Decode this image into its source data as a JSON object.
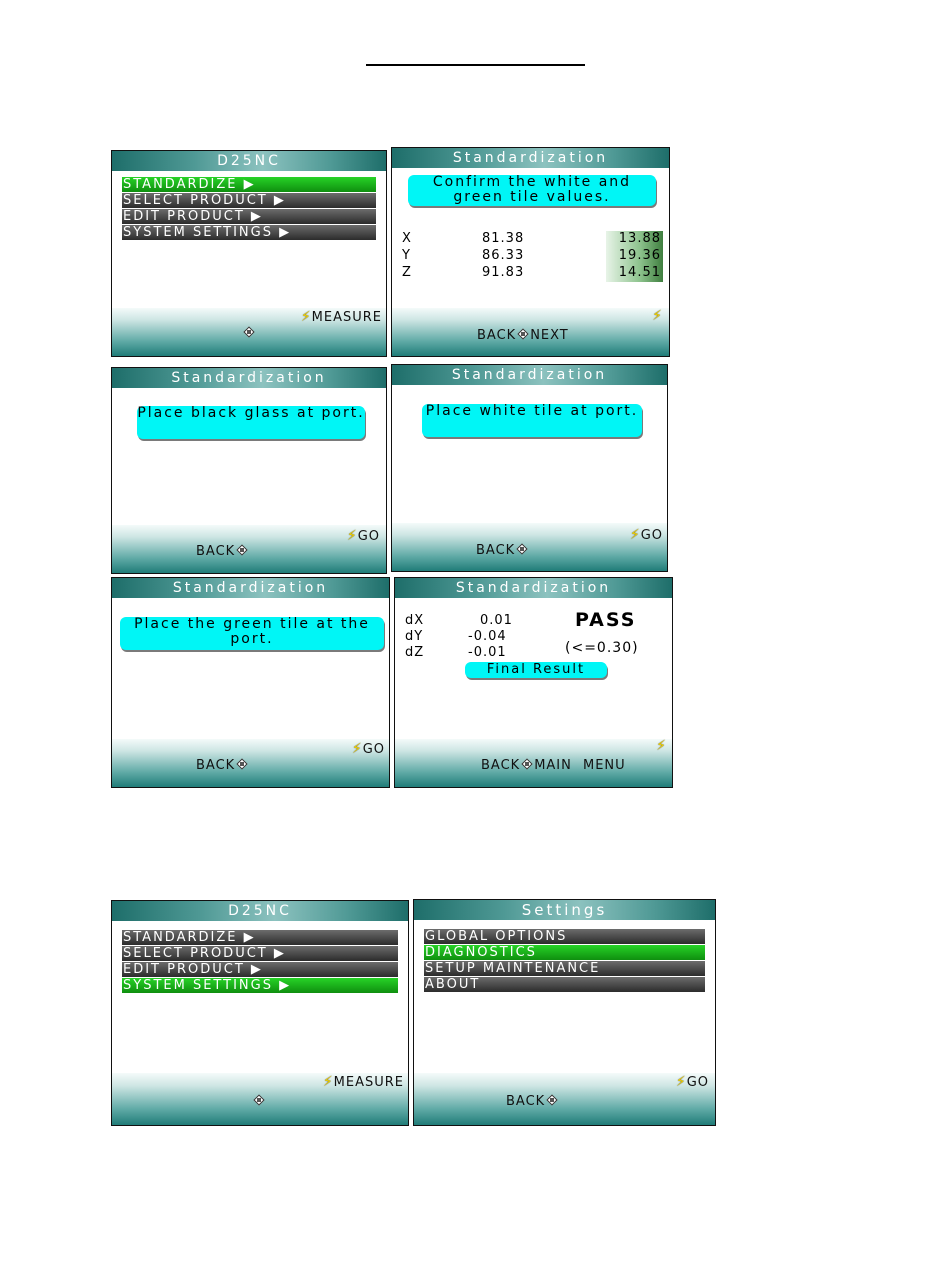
{
  "screens": {
    "main1": {
      "title": "D25NC",
      "menu": [
        "STANDARDIZE ▶",
        "SELECT PRODUCT ▶",
        "EDIT PRODUCT ▶",
        "SYSTEM SETTINGS ▶"
      ],
      "selected_index": 0,
      "softkey_right": "MEASURE"
    },
    "confirm": {
      "title": "Standardization",
      "message": "Confirm the white and green tile values.",
      "rows": [
        {
          "label": "X",
          "white": "81.38",
          "green": "13.88"
        },
        {
          "label": "Y",
          "white": "86.33",
          "green": "19.36"
        },
        {
          "label": "Z",
          "white": "91.83",
          "green": "14.51"
        }
      ],
      "softkey_left": "BACK",
      "softkey_right": "NEXT"
    },
    "black": {
      "title": "Standardization",
      "message": "Place black glass at port.",
      "softkey_left": "BACK",
      "softkey_right": "GO"
    },
    "white": {
      "title": "Standardization",
      "message": "Place white tile at port.",
      "softkey_left": "BACK",
      "softkey_right": "GO"
    },
    "green": {
      "title": "Standardization",
      "message": "Place the green tile at the port.",
      "softkey_left": "BACK",
      "softkey_right": "GO"
    },
    "result": {
      "title": "Standardization",
      "rows": [
        {
          "label": "dX",
          "value": "0.01"
        },
        {
          "label": "dY",
          "value": "-0.04"
        },
        {
          "label": "dZ",
          "value": "-0.01"
        }
      ],
      "status": "PASS",
      "tolerance": "(<=0.30)",
      "final_label": "Final Result",
      "softkey_left": "BACK",
      "softkey_right": "MAIN MENU"
    },
    "main2": {
      "title": "D25NC",
      "menu": [
        "STANDARDIZE ▶",
        "SELECT PRODUCT ▶",
        "EDIT PRODUCT ▶",
        "SYSTEM SETTINGS ▶"
      ],
      "selected_index": 3,
      "softkey_right": "MEASURE"
    },
    "settings": {
      "title": "Settings",
      "menu": [
        "GLOBAL OPTIONS",
        "DIAGNOSTICS",
        "SETUP MAINTENANCE",
        "ABOUT"
      ],
      "selected_index": 1,
      "softkey_left": "BACK",
      "softkey_right": "GO"
    }
  },
  "colors": {
    "highlight": "#1fbf1f",
    "bubble": "#00f6f6",
    "bolt": "#f2d200",
    "teal": "#207c78"
  },
  "icons": [
    "lightning-icon",
    "navigation-pad-icon",
    "arrow-right-icon"
  ]
}
